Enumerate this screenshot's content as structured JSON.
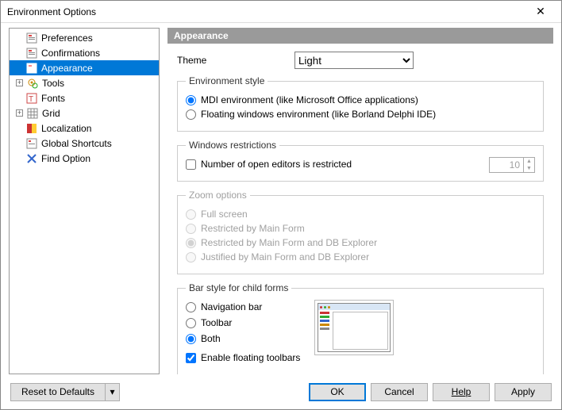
{
  "window": {
    "title": "Environment Options"
  },
  "tree": {
    "items": [
      {
        "label": "Preferences",
        "depth": 1,
        "exp": ""
      },
      {
        "label": "Confirmations",
        "depth": 1,
        "exp": ""
      },
      {
        "label": "Appearance",
        "depth": 1,
        "exp": "",
        "selected": true
      },
      {
        "label": "Tools",
        "depth": 0,
        "exp": "+"
      },
      {
        "label": "Fonts",
        "depth": 1,
        "exp": ""
      },
      {
        "label": "Grid",
        "depth": 0,
        "exp": "+"
      },
      {
        "label": "Localization",
        "depth": 1,
        "exp": ""
      },
      {
        "label": "Global Shortcuts",
        "depth": 1,
        "exp": ""
      },
      {
        "label": "Find Option",
        "depth": 1,
        "exp": ""
      }
    ]
  },
  "page": {
    "title": "Appearance",
    "theme_label": "Theme",
    "theme_value": "Light",
    "env_style": {
      "legend": "Environment style",
      "opt1": "MDI environment (like Microsoft Office applications)",
      "opt2": "Floating windows environment (like Borland Delphi IDE)"
    },
    "win_restrict": {
      "legend": "Windows restrictions",
      "chk": "Number of open editors is restricted",
      "val": "10"
    },
    "zoom": {
      "legend": "Zoom options",
      "o1": "Full screen",
      "o2": "Restricted by Main Form",
      "o3": "Restricted by Main Form and DB Explorer",
      "o4": "Justified by Main Form and DB Explorer"
    },
    "bar": {
      "legend": "Bar style for child forms",
      "o1": "Navigation bar",
      "o2": "Toolbar",
      "o3": "Both",
      "chk": "Enable floating toolbars"
    }
  },
  "footer": {
    "reset": "Reset to Defaults",
    "ok": "OK",
    "cancel": "Cancel",
    "help": "Help",
    "apply": "Apply"
  }
}
